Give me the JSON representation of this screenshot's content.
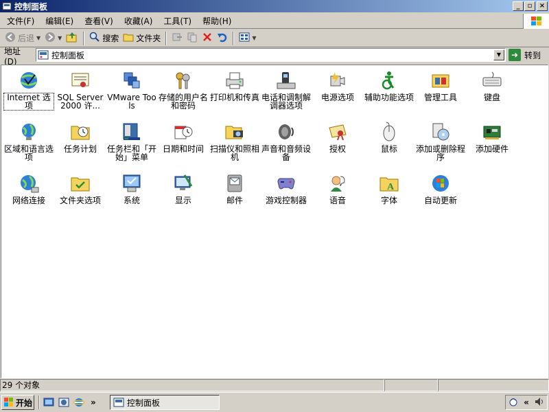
{
  "window": {
    "title": "控制面板"
  },
  "menu": [
    "文件(F)",
    "编辑(E)",
    "查看(V)",
    "收藏(A)",
    "工具(T)",
    "帮助(H)"
  ],
  "toolbar": {
    "back": "后退",
    "search": "搜索",
    "folders": "文件夹"
  },
  "address": {
    "label": "地址(D)",
    "value": "控制面板",
    "go": "转到"
  },
  "items": [
    {
      "label": "Internet 选项",
      "icon": "internet-options-icon"
    },
    {
      "label": "SQL Server 2000 许...",
      "icon": "sql-server-icon"
    },
    {
      "label": "VMware Tools",
      "icon": "vmware-tools-icon"
    },
    {
      "label": "存储的用户名和密码",
      "icon": "stored-passwords-icon"
    },
    {
      "label": "打印机和传真",
      "icon": "printers-faxes-icon"
    },
    {
      "label": "电话和调制解调器选项",
      "icon": "phone-modem-icon"
    },
    {
      "label": "电源选项",
      "icon": "power-options-icon"
    },
    {
      "label": "辅助功能选项",
      "icon": "accessibility-icon"
    },
    {
      "label": "管理工具",
      "icon": "admin-tools-icon"
    },
    {
      "label": "键盘",
      "icon": "keyboard-icon"
    },
    {
      "label": "区域和语言选项",
      "icon": "region-language-icon"
    },
    {
      "label": "任务计划",
      "icon": "scheduled-tasks-icon"
    },
    {
      "label": "任务栏和「开始」菜单",
      "icon": "taskbar-start-icon"
    },
    {
      "label": "日期和时间",
      "icon": "date-time-icon"
    },
    {
      "label": "扫描仪和照相机",
      "icon": "scanner-camera-icon"
    },
    {
      "label": "声音和音频设备",
      "icon": "sound-audio-icon"
    },
    {
      "label": "授权",
      "icon": "licensing-icon"
    },
    {
      "label": "鼠标",
      "icon": "mouse-icon"
    },
    {
      "label": "添加或删除程序",
      "icon": "add-remove-programs-icon"
    },
    {
      "label": "添加硬件",
      "icon": "add-hardware-icon"
    },
    {
      "label": "网络连接",
      "icon": "network-connections-icon"
    },
    {
      "label": "文件夹选项",
      "icon": "folder-options-icon"
    },
    {
      "label": "系统",
      "icon": "system-icon"
    },
    {
      "label": "显示",
      "icon": "display-icon"
    },
    {
      "label": "邮件",
      "icon": "mail-icon"
    },
    {
      "label": "游戏控制器",
      "icon": "game-controllers-icon"
    },
    {
      "label": "语音",
      "icon": "speech-icon"
    },
    {
      "label": "字体",
      "icon": "fonts-icon"
    },
    {
      "label": "自动更新",
      "icon": "automatic-updates-icon"
    }
  ],
  "status": {
    "count": "29 个对象"
  },
  "taskbar": {
    "start": "开始",
    "active_task": "控制面板",
    "overflow": "»"
  },
  "colors": {
    "titlebar_start": "#0a246a",
    "titlebar_end": "#a6caf0",
    "face": "#d4d0c8"
  }
}
